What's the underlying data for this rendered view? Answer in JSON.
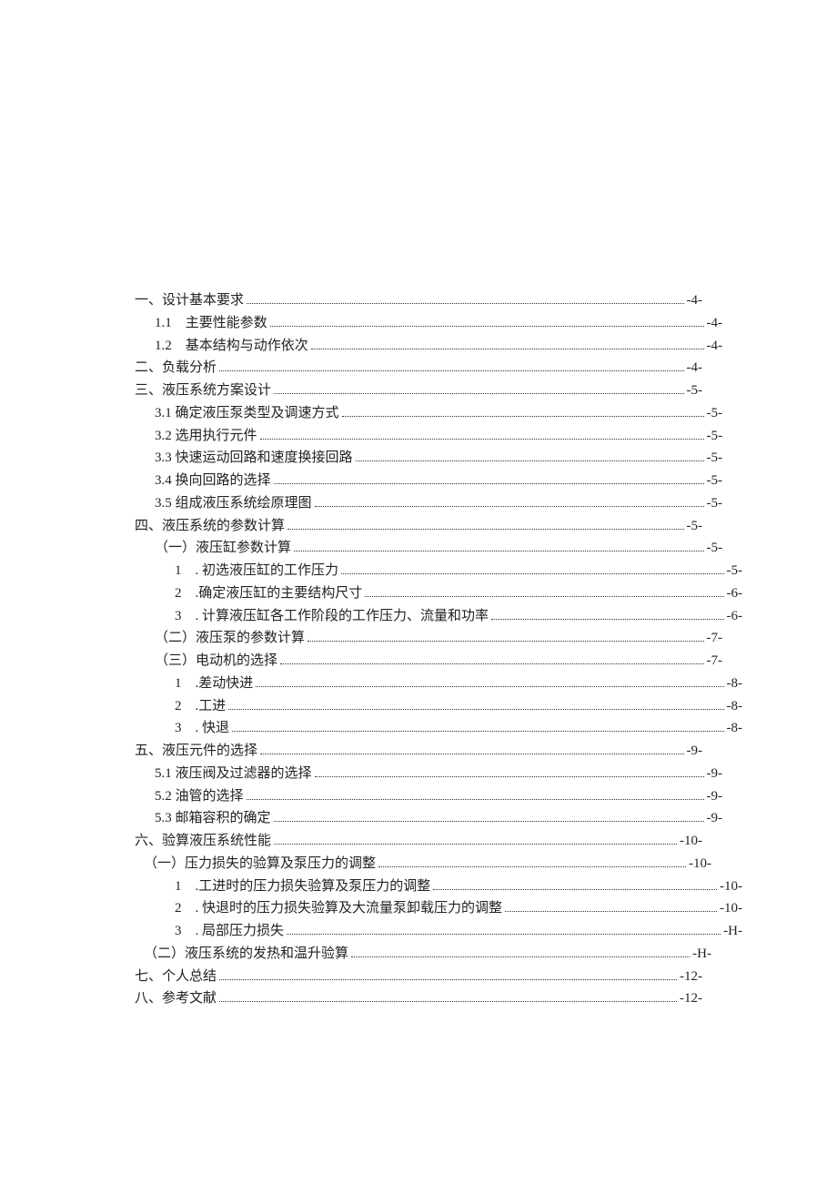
{
  "toc": [
    {
      "label": "一、设计基本要求",
      "page": "-4-",
      "indent": 0
    },
    {
      "label": "1.1    主要性能参数",
      "page": "-4-",
      "indent": 1
    },
    {
      "label": "1.2    基本结构与动作依次",
      "page": "-4-",
      "indent": 1
    },
    {
      "label": "二、负载分析",
      "page": "-4-",
      "indent": 0
    },
    {
      "label": "三、液压系统方案设计",
      "page": "-5-",
      "indent": 0
    },
    {
      "label": "3.1 确定液压泵类型及调速方式",
      "page": "-5-",
      "indent": 1
    },
    {
      "label": "3.2 选用执行元件",
      "page": "-5-",
      "indent": 1
    },
    {
      "label": "3.3 快速运动回路和速度换接回路",
      "page": "-5-",
      "indent": 1
    },
    {
      "label": "3.4 换向回路的选择",
      "page": "-5-",
      "indent": 1
    },
    {
      "label": "3.5 组成液压系统绘原理图",
      "page": "-5-",
      "indent": 1
    },
    {
      "label": "四、液压系统的参数计算",
      "page": "-5-",
      "indent": 0
    },
    {
      "label": "（一）液压缸参数计算",
      "page": "-5-",
      "indent": 1
    },
    {
      "label": "1    . 初选液压缸的工作压力",
      "page": "-5-",
      "indent": 2
    },
    {
      "label": "2    .确定液压缸的主要结构尺寸",
      "page": "-6-",
      "indent": 2
    },
    {
      "label": "3    . 计算液压缸各工作阶段的工作压力、流量和功率",
      "page": "-6-",
      "indent": 2
    },
    {
      "label": "（二）液压泵的参数计算",
      "page": "-7-",
      "indent": 1
    },
    {
      "label": "（三）电动机的选择",
      "page": "-7-",
      "indent": 1
    },
    {
      "label": "1    .差动快进",
      "page": "-8-",
      "indent": 2
    },
    {
      "label": "2    .工进",
      "page": "-8-",
      "indent": 2
    },
    {
      "label": "3    . 快退",
      "page": "-8-",
      "indent": 2
    },
    {
      "label": "五、液压元件的选择",
      "page": "-9-",
      "indent": 0
    },
    {
      "label": "5.1 液压阀及过滤器的选择",
      "page": "-9-",
      "indent": 1
    },
    {
      "label": "5.2 油管的选择",
      "page": "-9-",
      "indent": 1
    },
    {
      "label": "5.3 邮箱容积的确定",
      "page": "-9-",
      "indent": 1
    },
    {
      "label": "六、验算液压系统性能",
      "page": "-10-",
      "indent": 0
    },
    {
      "label": "（一）压力损失的验算及泵压力的调整",
      "page": "-10-",
      "indent": 3
    },
    {
      "label": "1    .工进时的压力损失验算及泵压力的调整",
      "page": "-10-",
      "indent": 2
    },
    {
      "label": "2    . 快退时的压力损失验算及大流量泵卸载压力的调整",
      "page": "-10-",
      "indent": 2
    },
    {
      "label": "3    . 局部压力损失",
      "page": "-H-",
      "indent": 2
    },
    {
      "label": "（二）液压系统的发热和温升验算",
      "page": "-H-",
      "indent": 3
    },
    {
      "label": "七、个人总结",
      "page": "-12-",
      "indent": 0
    },
    {
      "label": "八、参考文献",
      "page": "-12-",
      "indent": 0
    }
  ]
}
